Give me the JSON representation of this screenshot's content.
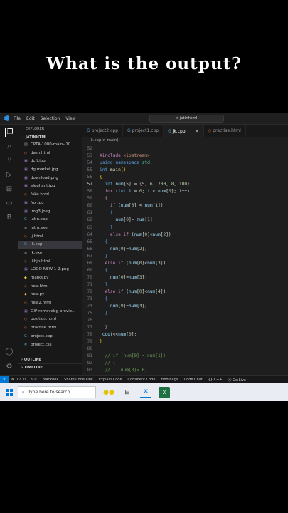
{
  "caption": "What is the output?",
  "titlebar": {
    "menu": [
      "File",
      "Edit",
      "Selection",
      "View",
      "···"
    ],
    "search": "jatinhtml"
  },
  "explorer": {
    "header": "EXPLORER",
    "root": "JATINHTML",
    "files": [
      {
        "name": "CPTA-1080-main--10...",
        "icon": "file-icon"
      },
      {
        "name": "dash.html",
        "icon": "html-icon"
      },
      {
        "name": "dcft.jpg",
        "icon": "image-icon"
      },
      {
        "name": "dg market.jpg",
        "icon": "image-icon"
      },
      {
        "name": "download.png",
        "icon": "image-icon"
      },
      {
        "name": "elephant.jpg",
        "icon": "image-icon"
      },
      {
        "name": "fake.html",
        "icon": "html-icon"
      },
      {
        "name": "fox.jpg",
        "icon": "image-icon"
      },
      {
        "name": "img3.jpeg",
        "icon": "image-icon"
      },
      {
        "name": "jatin.cpp",
        "icon": "cpp-icon"
      },
      {
        "name": "jatin.exe",
        "icon": "exe-icon"
      },
      {
        "name": "jj.html",
        "icon": "html-icon"
      },
      {
        "name": "jk.cpp",
        "icon": "cpp-icon",
        "selected": true
      },
      {
        "name": "jk.exe",
        "icon": "exe-icon"
      },
      {
        "name": "jkhjh.html",
        "icon": "html-icon"
      },
      {
        "name": "LOGO-NEW-1-2.png",
        "icon": "image-icon"
      },
      {
        "name": "marks.py",
        "icon": "python-icon"
      },
      {
        "name": "new.html",
        "icon": "html-icon"
      },
      {
        "name": "new.py",
        "icon": "python-icon"
      },
      {
        "name": "new2.html",
        "icon": "html-icon"
      },
      {
        "name": "OIP-removebg-previe...",
        "icon": "image-icon"
      },
      {
        "name": "position.html",
        "icon": "html-icon"
      },
      {
        "name": "practise.html",
        "icon": "html-icon"
      },
      {
        "name": "project.cpp",
        "icon": "cpp-icon"
      },
      {
        "name": "project.css",
        "icon": "css-icon"
      }
    ],
    "outline": "OUTLINE",
    "timeline": "TIMELINE"
  },
  "tabs": [
    {
      "label": "project2.cpp",
      "active": false
    },
    {
      "label": "project1.cpp",
      "active": false
    },
    {
      "label": "jk.cpp",
      "active": true
    },
    {
      "label": "practise.html",
      "active": false
    }
  ],
  "breadcrumb": "jk.cpp > main()",
  "editor": {
    "current_line": 57,
    "lines": [
      {
        "n": 52,
        "html": ""
      },
      {
        "n": 53,
        "html": "<span class='pp'>#include</span> <span class='st'>&lt;iostream&gt;</span>"
      },
      {
        "n": 54,
        "html": "<span class='kw'>using namespace</span> <span class='ty'>std</span>;"
      },
      {
        "n": 55,
        "html": "<span class='kw'>int</span> <span class='fn'>main</span><span class='br'>()</span>"
      },
      {
        "n": 56,
        "html": "<span class='br'>{</span>"
      },
      {
        "n": 57,
        "html": "  <span class='kw'>int</span> <span class='vr'>num</span>[<span class='nm'>5</span>] = <span class='pp'>{</span><span class='nm'>5</span>, <span class='nm'>6</span>, <span class='nm'>700</span>, <span class='nm'>8</span>, <span class='nm'>100</span><span class='pp'>}</span>;"
      },
      {
        "n": 58,
        "html": "  <span class='pp'>for</span> (<span class='kw'>int</span> <span class='vr'>i</span> = <span class='nm'>0</span>; <span class='vr'>i</span> &lt; <span class='vr'>num</span>[<span class='nm'>0</span>]; <span class='vr'>i</span>++)"
      },
      {
        "n": 59,
        "html": "  <span class='pp'>{</span>"
      },
      {
        "n": 60,
        "html": "    <span class='pp'>if</span> (<span class='vr'>num</span>[<span class='nm'>0</span>] &lt; <span class='vr'>num</span>[<span class='nm'>1</span>])"
      },
      {
        "n": 61,
        "html": "    <span class='kw'>{</span>"
      },
      {
        "n": 62,
        "html": "      <span class='vr'>num</span>[<span class='nm'>0</span>]= <span class='vr'>num</span>[<span class='nm'>1</span>];"
      },
      {
        "n": 63,
        "html": "    <span class='kw'>}</span>"
      },
      {
        "n": 64,
        "html": "    <span class='pp'>else if</span> (<span class='vr'>num</span>[<span class='nm'>0</span>]&lt;<span class='vr'>num</span>[<span class='nm'>2</span>])"
      },
      {
        "n": 65,
        "html": "  <span class='kw'>{</span>"
      },
      {
        "n": 66,
        "html": "    <span class='vr'>num</span>[<span class='nm'>0</span>]=<span class='vr'>num</span>[<span class='nm'>2</span>];"
      },
      {
        "n": 67,
        "html": "  <span class='kw'>}</span>"
      },
      {
        "n": 68,
        "html": "  <span class='pp'>else if</span> (<span class='vr'>num</span>[<span class='nm'>0</span>]&lt;<span class='vr'>num</span>[<span class='nm'>3</span>])"
      },
      {
        "n": 69,
        "html": "  <span class='kw'>{</span>"
      },
      {
        "n": 70,
        "html": "    <span class='vr'>num</span>[<span class='nm'>0</span>]=<span class='vr'>num</span>[<span class='nm'>3</span>];"
      },
      {
        "n": 71,
        "html": "  <span class='kw'>}</span>"
      },
      {
        "n": 72,
        "html": "  <span class='pp'>else if</span> (<span class='vr'>num</span>[<span class='nm'>0</span>]&lt;<span class='vr'>num</span>[<span class='nm'>4</span>])"
      },
      {
        "n": 73,
        "html": "  <span class='kw'>{</span>"
      },
      {
        "n": 74,
        "html": "    <span class='vr'>num</span>[<span class='nm'>0</span>]=<span class='vr'>num</span>[<span class='nm'>4</span>];"
      },
      {
        "n": 75,
        "html": "  <span class='kw'>}</span>"
      },
      {
        "n": 76,
        "html": ""
      },
      {
        "n": 77,
        "html": "  <span class='pp'>}</span>"
      },
      {
        "n": 78,
        "html": " <span class='vr'>cout</span>&lt;&lt;<span class='vr'>num</span>[<span class='nm'>0</span>];"
      },
      {
        "n": 79,
        "html": "<span class='br'>}</span>"
      },
      {
        "n": 80,
        "html": ""
      },
      {
        "n": 81,
        "html": "  <span class='cm'>// if (num[0] &lt; num[1])</span>"
      },
      {
        "n": 82,
        "html": "  <span class='cm'>// {</span>"
      },
      {
        "n": 83,
        "html": "  <span class='cm'>//    num[0]= 6;</span>"
      }
    ]
  },
  "statusbar": {
    "items": [
      "⊗ 0 ⚠ 0",
      "⍉ 0",
      "Blackbox",
      "Share Code Link",
      "Explain Code",
      "Comment Code",
      "Find Bugs",
      "Code Chat",
      "{} C++",
      "⦿ Go Live"
    ]
  },
  "taskbar": {
    "search_placeholder": "Type here to search"
  }
}
